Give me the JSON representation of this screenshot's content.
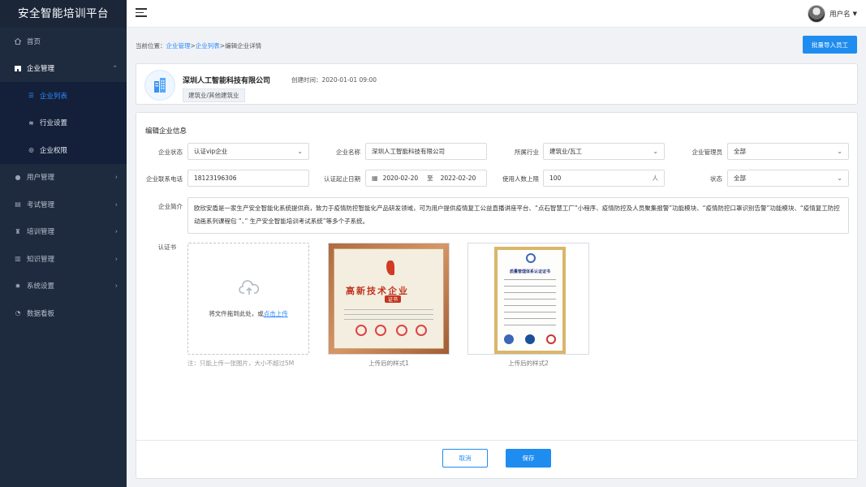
{
  "brand": "安全智能培训平台",
  "sidebar": {
    "items": [
      {
        "label": "首页",
        "icon": "home-icon"
      },
      {
        "label": "企业管理",
        "icon": "building-icon"
      },
      {
        "label": "用户管理",
        "icon": "user-icon"
      },
      {
        "label": "考试管理",
        "icon": "exam-icon"
      },
      {
        "label": "培训管理",
        "icon": "training-icon"
      },
      {
        "label": "知识管理",
        "icon": "book-icon"
      },
      {
        "label": "系统设置",
        "icon": "gear-icon"
      },
      {
        "label": "数据看板",
        "icon": "dashboard-icon"
      }
    ],
    "submenu": [
      {
        "label": "企业列表",
        "icon": "list-icon",
        "active": true
      },
      {
        "label": "行业设置",
        "icon": "sliders-icon"
      },
      {
        "label": "企业权限",
        "icon": "shield-icon"
      }
    ]
  },
  "header": {
    "username": "用户名"
  },
  "breadcrumb": {
    "prefix": "当前位置：",
    "level1": "企业管理",
    "sep1": ">",
    "level2": "企业列表",
    "sep2": ">",
    "current": "编辑企业详情"
  },
  "actions": {
    "batch_import": "批量导入员工"
  },
  "company": {
    "name": "深圳人工智能科技有限公司",
    "created": "创建时间：2020-01-01  09:00",
    "industry_tag": "建筑业/其他建筑业"
  },
  "form": {
    "title": "编辑企业信息",
    "status_label": "企业状态",
    "status_value": "认证vip企业",
    "name_label": "企业名称",
    "name_value": "深圳人工智能科技有限公司",
    "industry_label": "所属行业",
    "industry_value": "建筑业/瓦工",
    "admin_label": "企业管理员",
    "admin_value": "全部",
    "phone_label": "企业联系电话",
    "phone_value": "18123196306",
    "cert_date_label": "认证起止日期",
    "cert_start": "2020-02-20",
    "cert_to": "至",
    "cert_end": "2022-02-20",
    "limit_label": "使用人数上限",
    "limit_value": "100",
    "limit_unit": "人",
    "state_label": "状态",
    "state_value": "全部",
    "intro_label": "企业简介",
    "intro_value": "欧欣安盾是一家生产安全智能化系统提供商，致力于疫情防控智能化产品研发领域，可为用户提供疫情复工公益直播讲座平台、“点石智慧工厂”小程序、疫情防控及人员聚集报警”功能模块、“疫情防控口罩识别告警”功能模块、“疫情复工防控动画系列课程包 ”、” 生产安全智能培训考试系统”等多个子系统。",
    "cert_label": "认证书",
    "upload_text": "将文件拖到此处，或",
    "upload_link": "点击上传",
    "upload_hint": "注：只能上传一张图片，大小不超过5M",
    "sample1_caption": "上传后的样式1",
    "sample2_caption": "上传后的样式2",
    "sample1_title": "高新技术企业",
    "sample1_sub": "证书",
    "sample2_title": "质量管理体系认证证书"
  },
  "footer": {
    "cancel": "取消",
    "save": "保存"
  },
  "colors": {
    "sidebar": "#1e2b3f",
    "primary": "#1f8cf0",
    "active": "#2c8bff"
  }
}
